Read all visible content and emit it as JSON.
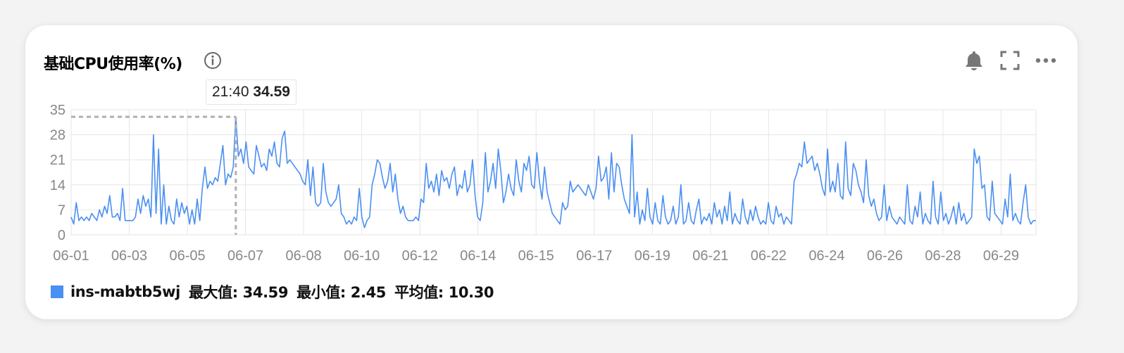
{
  "title": "基础CPU使用率(%)",
  "icons": {
    "info": "info-icon",
    "alarm": "bell-icon",
    "fullscreen": "fullscreen-icon",
    "more": "more-icon"
  },
  "tooltip": {
    "time": "21:40",
    "value": "34.59"
  },
  "legend": {
    "series_name": "ins-mabtb5wj",
    "max": "最大值: 34.59",
    "min": "最小值: 2.45",
    "avg": "平均值: 10.30"
  },
  "colors": {
    "series": "#4a8ff2",
    "grid": "#e6e6e6",
    "crosshair": "#b0b0b0"
  },
  "chart_data": {
    "type": "line",
    "title": "基础CPU使用率(%)",
    "x_ticks": [
      "06-01",
      "06-03",
      "06-05",
      "06-07",
      "06-08",
      "06-10",
      "06-12",
      "06-14",
      "06-15",
      "06-17",
      "06-19",
      "06-21",
      "06-22",
      "06-24",
      "06-26",
      "06-28",
      "06-29"
    ],
    "y_ticks": [
      0,
      7,
      14,
      21,
      28,
      35
    ],
    "ylim": [
      0,
      35
    ],
    "grid": true,
    "series": [
      {
        "name": "ins-mabtb5wj",
        "values": [
          5,
          3,
          9,
          4,
          5,
          4,
          5,
          4,
          6,
          5,
          4,
          7,
          5,
          8,
          6,
          11,
          5,
          5,
          6,
          4,
          13,
          4,
          4,
          4,
          4,
          5,
          10,
          6,
          11,
          8,
          10,
          5,
          28,
          6,
          24,
          3,
          14,
          3,
          8,
          4,
          3,
          10,
          5,
          9,
          6,
          8,
          3,
          7,
          3,
          10,
          4,
          13,
          19,
          13,
          15,
          14,
          16,
          15,
          20,
          25,
          14,
          17,
          16,
          19,
          33,
          22,
          24,
          20,
          26,
          19,
          18,
          17,
          25,
          22,
          19,
          20,
          18,
          24,
          22,
          26,
          20,
          19,
          27,
          29,
          20,
          21,
          20,
          19,
          18,
          17,
          15,
          14,
          21,
          11,
          19,
          9,
          8,
          9,
          20,
          12,
          9,
          8,
          9,
          10,
          14,
          6,
          5,
          3,
          4,
          3,
          5,
          4,
          13,
          5,
          2,
          4,
          5,
          14,
          17,
          21,
          20,
          16,
          13,
          15,
          20,
          12,
          17,
          10,
          6,
          8,
          5,
          4,
          4,
          4,
          5,
          4,
          10,
          9,
          20,
          13,
          15,
          12,
          17,
          11,
          18,
          15,
          16,
          13,
          17,
          19,
          11,
          14,
          13,
          18,
          12,
          14,
          21,
          11,
          5,
          4,
          9,
          23,
          12,
          15,
          20,
          13,
          24,
          18,
          9,
          12,
          17,
          13,
          11,
          21,
          15,
          12,
          20,
          18,
          22,
          14,
          13,
          23,
          15,
          10,
          19,
          12,
          9,
          6,
          5,
          4,
          3,
          9,
          7,
          8,
          15,
          12,
          13,
          14,
          13,
          12,
          11,
          14,
          12,
          10,
          13,
          22,
          15,
          16,
          19,
          10,
          23,
          12,
          20,
          19,
          14,
          10,
          8,
          6,
          28,
          5,
          12,
          3,
          7,
          4,
          13,
          5,
          3,
          9,
          4,
          3,
          11,
          5,
          3,
          4,
          8,
          3,
          5,
          14,
          3,
          4,
          9,
          4,
          3,
          7,
          10,
          3,
          5,
          4,
          6,
          3,
          9,
          5,
          7,
          3,
          8,
          4,
          12,
          3,
          6,
          4,
          3,
          10,
          5,
          3,
          7,
          4,
          8,
          5,
          3,
          4,
          3,
          9,
          4,
          3,
          8,
          5,
          6,
          3,
          5,
          4,
          3,
          15,
          17,
          20,
          19,
          26,
          20,
          21,
          22,
          18,
          20,
          17,
          13,
          11,
          24,
          12,
          15,
          12,
          20,
          11,
          10,
          26,
          13,
          11,
          20,
          18,
          14,
          12,
          9,
          21,
          11,
          8,
          10,
          6,
          4,
          5,
          14,
          4,
          8,
          5,
          4,
          3,
          5,
          4,
          3,
          14,
          4,
          3,
          8,
          5,
          12,
          3,
          6,
          4,
          3,
          15,
          5,
          3,
          12,
          4,
          6,
          3,
          5,
          8,
          3,
          9,
          4,
          6,
          3,
          4,
          5,
          24,
          20,
          22,
          13,
          14,
          5,
          4,
          15,
          6,
          5,
          4,
          3,
          10,
          5,
          17,
          4,
          6,
          4,
          3,
          9,
          14,
          5,
          3,
          4,
          4
        ]
      }
    ]
  }
}
